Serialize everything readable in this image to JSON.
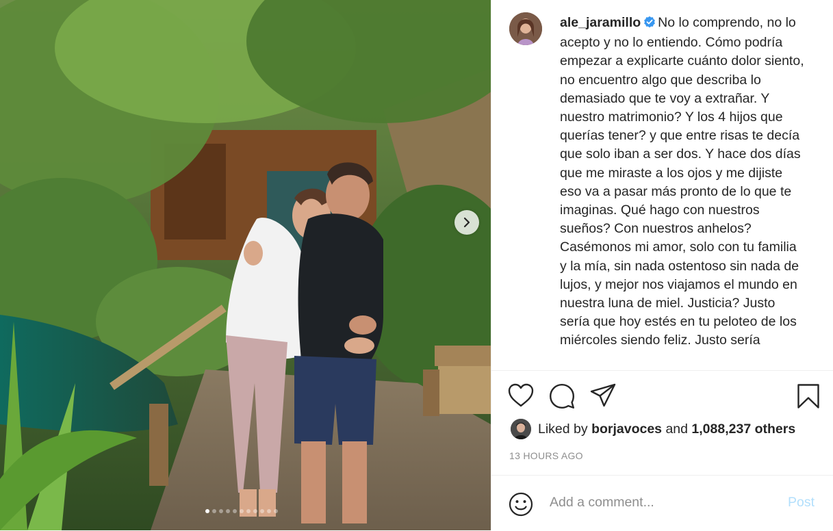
{
  "post": {
    "photo_alt": "Couple hugging in a tropical garden",
    "carousel": {
      "slide_count": 11,
      "active_index": 0
    }
  },
  "author": {
    "username": "ale_jaramillo",
    "verified": true
  },
  "caption": {
    "text": "No lo comprendo, no lo acepto y no lo entiendo. Cómo podría empezar a explicarte cuánto dolor siento, no encuentro algo que describa lo demasiado que te voy a extrañar. Y nuestro matrimonio? Y los 4 hijos que querías tener? y que entre risas te decía que solo iban a ser dos. Y hace dos días que me miraste a los ojos y me dijiste eso va a pasar más pronto de lo que te imaginas. Qué hago con nuestros sueños? Con nuestros anhelos? Casémonos mi amor, solo con tu familia y la mía, sin nada ostentoso sin nada de lujos, y mejor nos viajamos el mundo en nuestra luna de miel. Justicia? Justo sería que hoy estés en tu peloteo de los miércoles siendo feliz. Justo sería"
  },
  "likes": {
    "prefix": "Liked by",
    "liker": "borjavoces",
    "connector": "and",
    "others": "1,088,237 others"
  },
  "timestamp": "13 HOURS AGO",
  "comment": {
    "placeholder": "Add a comment...",
    "post_label": "Post"
  },
  "icons": {
    "like": "heart-icon",
    "comment": "comment-icon",
    "share": "paper-plane-icon",
    "save": "bookmark-icon",
    "emoji": "smiley-icon",
    "next": "chevron-right-icon"
  },
  "colors": {
    "verified_badge": "#3897f0",
    "post_button_disabled": "#b2dffc",
    "secondary_text": "#8e8e8e"
  }
}
